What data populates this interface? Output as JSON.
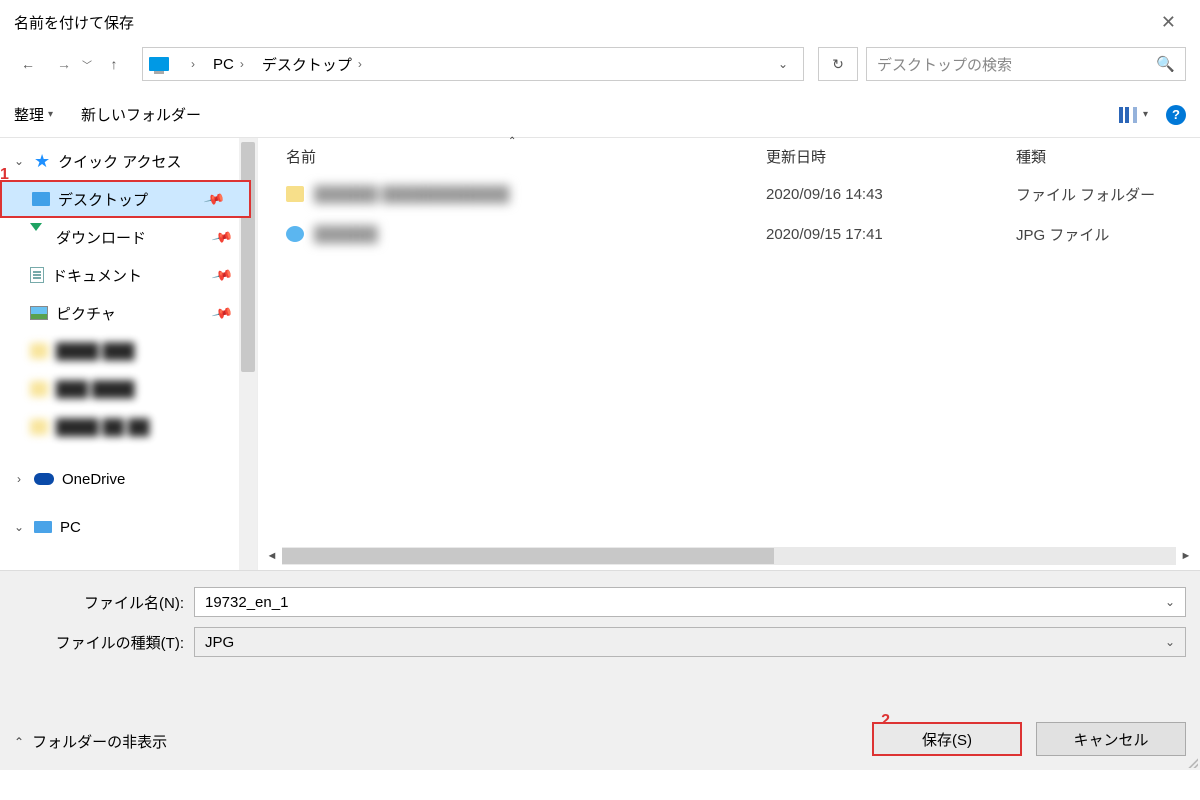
{
  "window": {
    "title": "名前を付けて保存"
  },
  "nav": {
    "crumb_pc": "PC",
    "crumb_desktop": "デスクトップ"
  },
  "search": {
    "placeholder": "デスクトップの検索"
  },
  "toolbar": {
    "organize": "整理",
    "new_folder": "新しいフォルダー"
  },
  "tree": {
    "quick_access": "クイック アクセス",
    "desktop": "デスクトップ",
    "downloads": "ダウンロード",
    "documents": "ドキュメント",
    "pictures": "ピクチャ",
    "onedrive": "OneDrive",
    "pc": "PC"
  },
  "columns": {
    "name": "名前",
    "date": "更新日時",
    "type": "種類"
  },
  "files": {
    "row0": {
      "date": "2020/09/16 14:43",
      "type": "ファイル フォルダー"
    },
    "row1": {
      "date": "2020/09/15 17:41",
      "type": "JPG ファイル"
    }
  },
  "form": {
    "filename_label": "ファイル名(N):",
    "filename_value": "19732_en_1",
    "filetype_label": "ファイルの種類(T):",
    "filetype_value": "JPG"
  },
  "footer": {
    "hide_folders": "フォルダーの非表示",
    "save": "保存(S)",
    "cancel": "キャンセル"
  },
  "annotations": {
    "one": "1",
    "two": "2"
  }
}
